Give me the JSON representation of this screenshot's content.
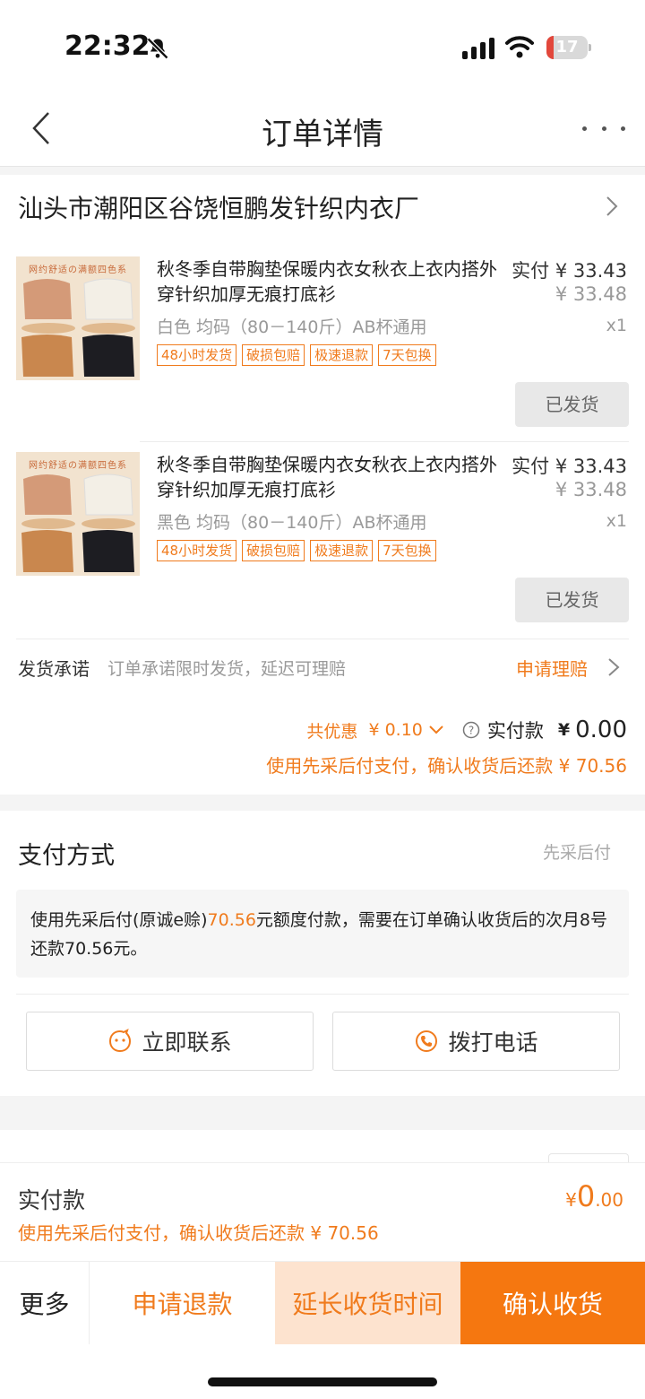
{
  "status_bar": {
    "time": "22:32",
    "battery": "17",
    "battery_level": 0.17,
    "icons": [
      "bell-off-icon",
      "cellular-signal-icon",
      "wifi-icon",
      "battery-icon"
    ]
  },
  "nav": {
    "title": "订单详情",
    "back_icon": "chevron-left-icon",
    "more_icon": "more-dots-icon"
  },
  "shop": {
    "name": "汕头市潮阳区谷饶恒鹏发针织内衣厂"
  },
  "products": [
    {
      "title": "秋冬季自带胸垫保暖内衣女秋衣上衣内搭外穿针织加厚无痕打底衫",
      "paid_price": "实付 ¥ 33.43",
      "original_price": "¥ 33.48",
      "spec": "白色 均码（80－140斤）AB杯通用",
      "qty": "x1",
      "tags": [
        "48小时发货",
        "破损包赔",
        "极速退款",
        "7天包换"
      ],
      "status_button": "已发货",
      "image_banner": "网约舒适の满额四色系"
    },
    {
      "title": "秋冬季自带胸垫保暖内衣女秋衣上衣内搭外穿针织加厚无痕打底衫",
      "paid_price": "实付 ¥ 33.43",
      "original_price": "¥ 33.48",
      "spec": "黑色 均码（80－140斤）AB杯通用",
      "qty": "x1",
      "tags": [
        "48小时发货",
        "破损包赔",
        "极速退款",
        "7天包换"
      ],
      "status_button": "已发货",
      "image_banner": "网约舒适の满额四色系"
    }
  ],
  "promise": {
    "label": "发货承诺",
    "text": "订单承诺限时发货，延迟可理赔",
    "link": "申请理赔"
  },
  "summary": {
    "discount_label": "共优惠",
    "discount_value": "¥ 0.10",
    "paid_label": "实付款",
    "paid_yen": "¥",
    "paid_value": "0.00",
    "pay_later_note": "使用先采后付支付，确认收货后还款 ¥ 70.56"
  },
  "payment": {
    "title": "支付方式",
    "method": "先采后付",
    "desc_prefix": "使用先采后付(原诚e赊)",
    "desc_amount": "70.56",
    "desc_suffix": "元额度付款，需要在订单确认收货后的次月8号还款70.56元。"
  },
  "contact": {
    "chat_label": "立即联系",
    "call_label": "拨打电话"
  },
  "total_bar": {
    "label": "实付款",
    "yen": "¥",
    "amount_int": "0",
    "amount_dec": ".00",
    "note": "使用先采后付支付，确认收货后还款 ¥ 70.56"
  },
  "actions": {
    "more": "更多",
    "refund": "申请退款",
    "extend": "延长收货时间",
    "confirm": "确认收货"
  },
  "colors": {
    "accent": "#f07b1d",
    "confirm_bg": "#f57710",
    "extend_bg": "#fde3cf"
  }
}
